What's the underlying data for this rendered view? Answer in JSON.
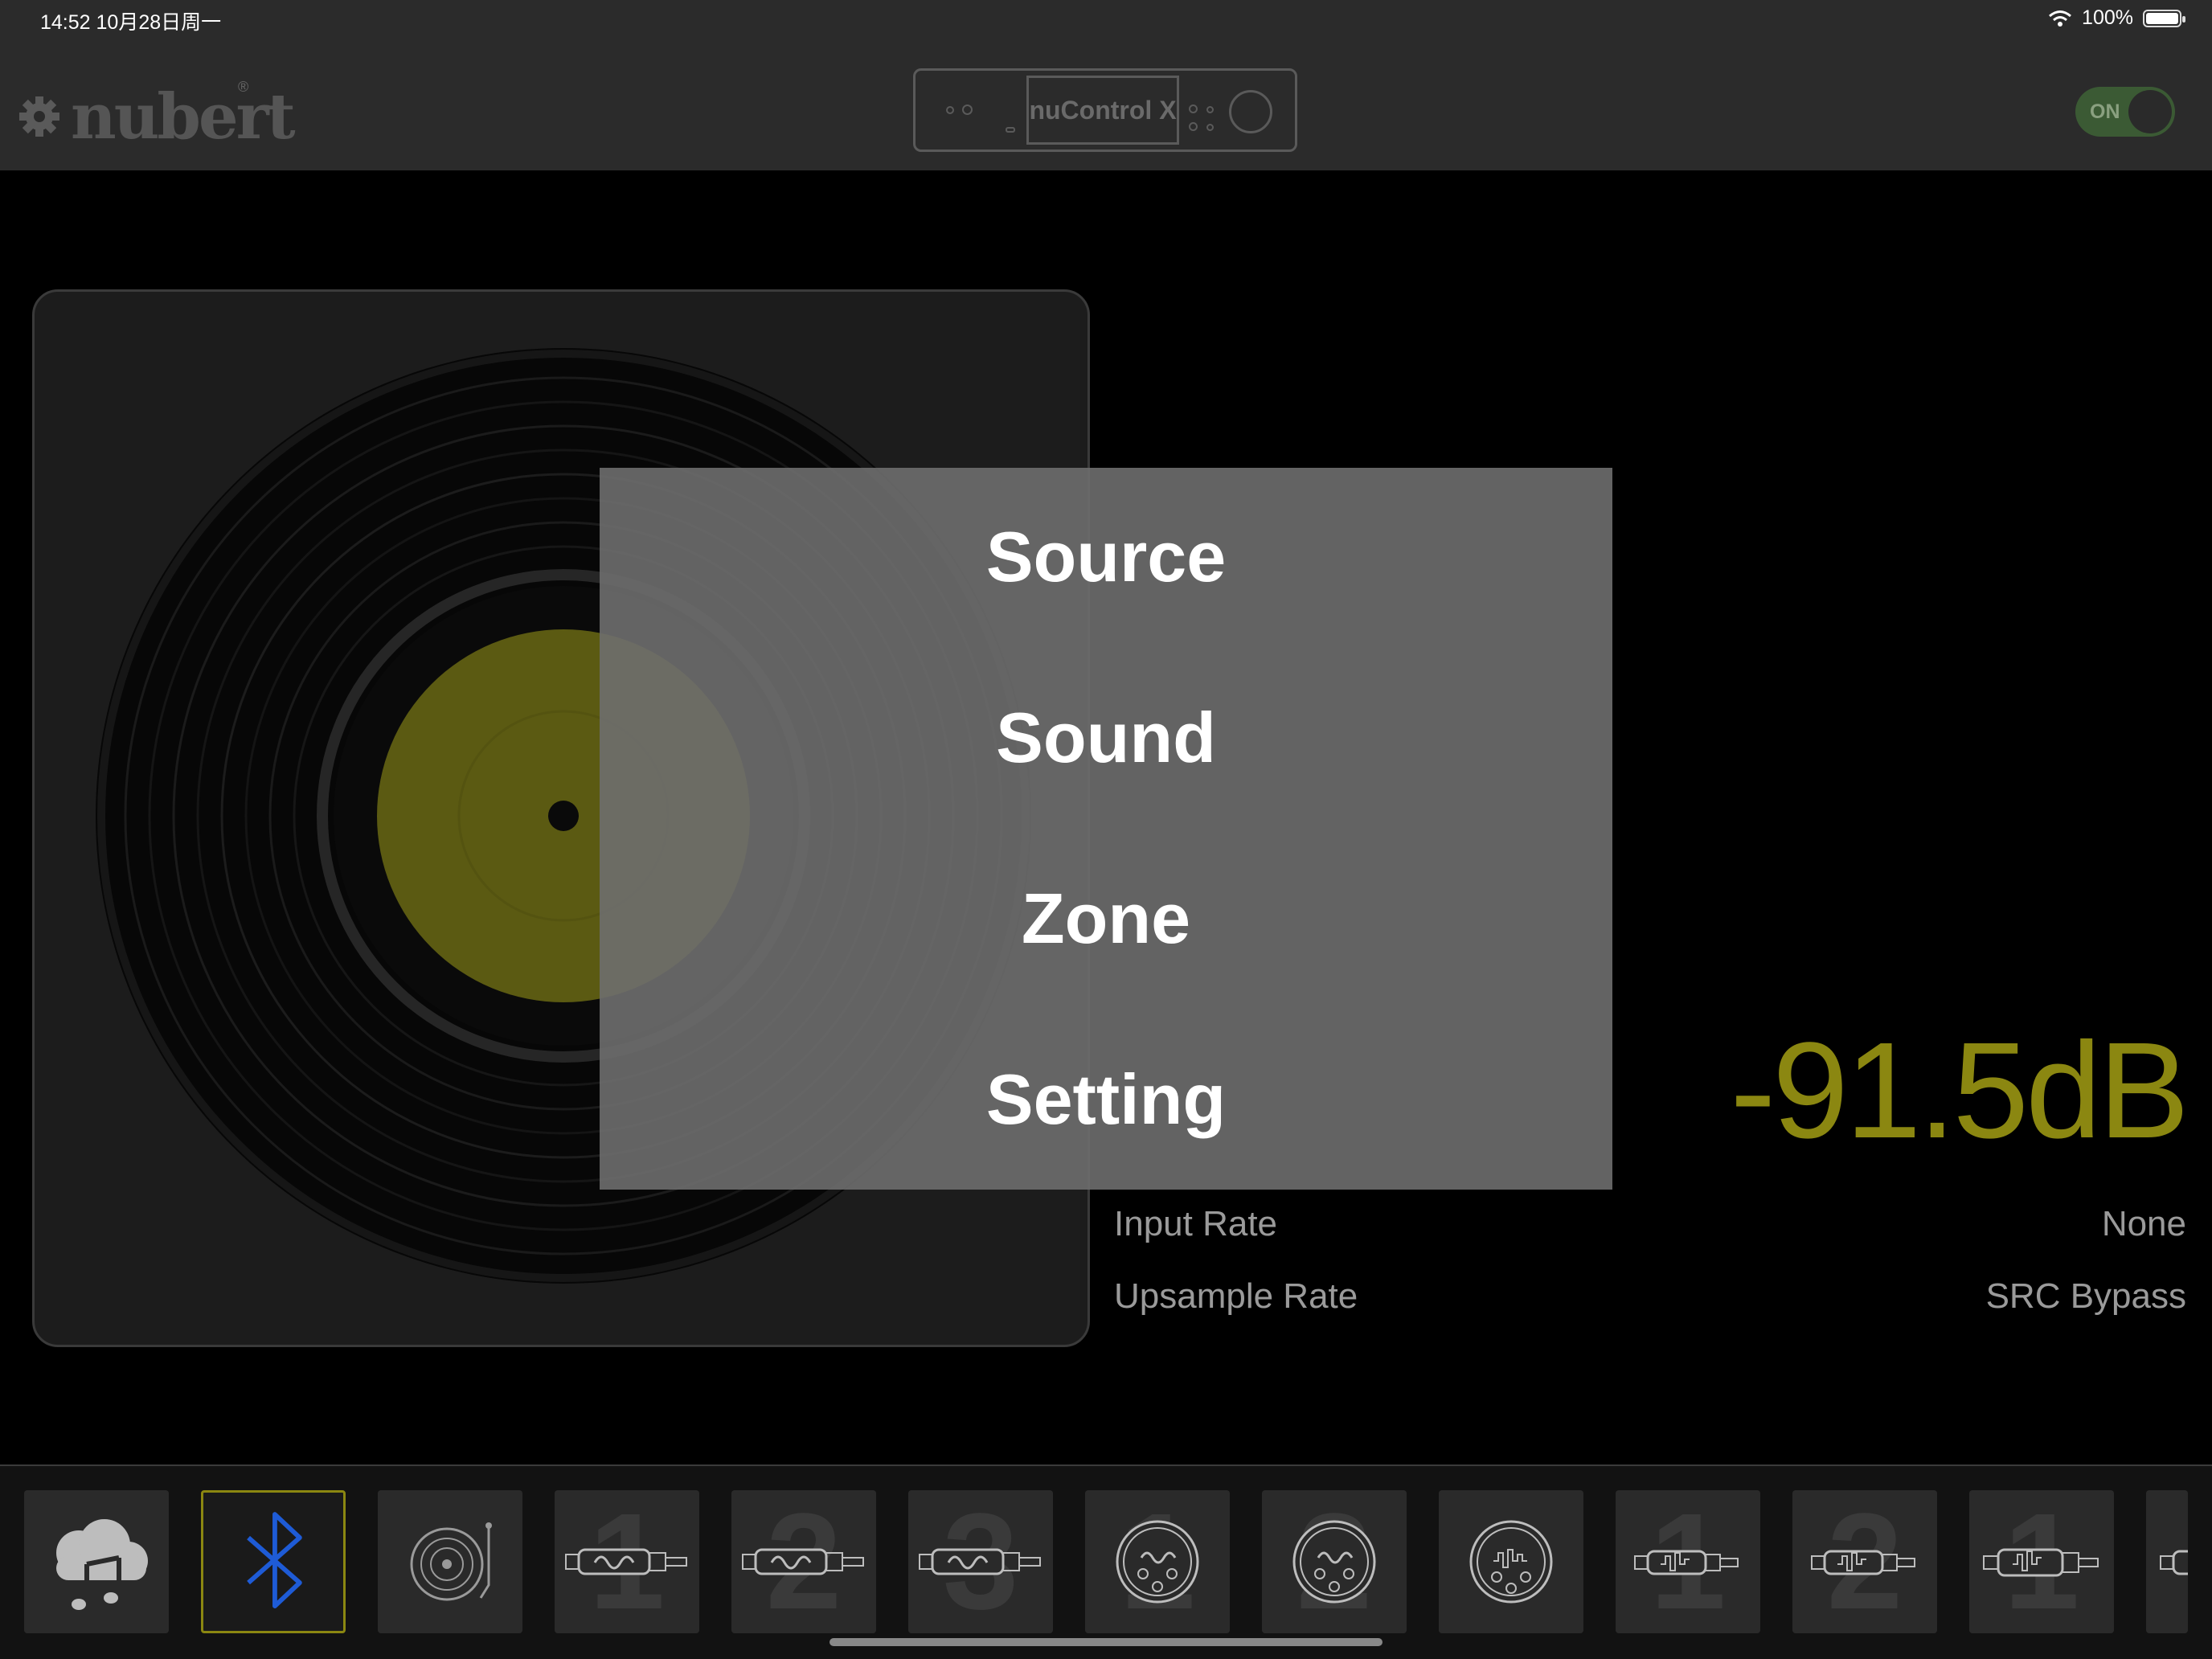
{
  "status_bar": {
    "time_date": "14:52   10月28日周一",
    "battery": "100%"
  },
  "header": {
    "logo": "nubert",
    "logo_mark": "®",
    "device_name": "nuControl X",
    "power": "ON"
  },
  "menu": [
    "Source",
    "Sound",
    "Zone",
    "Setting"
  ],
  "player": {
    "volume": "-91.5dB",
    "input_rate_label": "Input  Rate",
    "input_rate_value": "None",
    "upsample_label": "Upsample Rate",
    "upsample_value": "SRC Bypass"
  },
  "sources": [
    {
      "icon": "cloud-music-icon",
      "number": ""
    },
    {
      "icon": "bluetooth-icon",
      "number": "",
      "active": true
    },
    {
      "icon": "turntable-icon",
      "number": ""
    },
    {
      "icon": "rca-analog-icon",
      "number": "1"
    },
    {
      "icon": "rca-analog-icon",
      "number": "2"
    },
    {
      "icon": "rca-analog-icon",
      "number": "3"
    },
    {
      "icon": "xlr-analog-icon",
      "number": "1"
    },
    {
      "icon": "xlr-analog-icon",
      "number": "2"
    },
    {
      "icon": "xlr-digital-icon",
      "number": ""
    },
    {
      "icon": "coax-digital-icon",
      "number": "1"
    },
    {
      "icon": "coax-digital-icon",
      "number": "2"
    },
    {
      "icon": "optical-digital-icon",
      "number": "1"
    },
    {
      "icon": "more-sources-icon",
      "number": ""
    }
  ],
  "colors": {
    "accent": "#8b8711",
    "bluetooth": "#1e5bd6",
    "label": "#5b5a12"
  }
}
